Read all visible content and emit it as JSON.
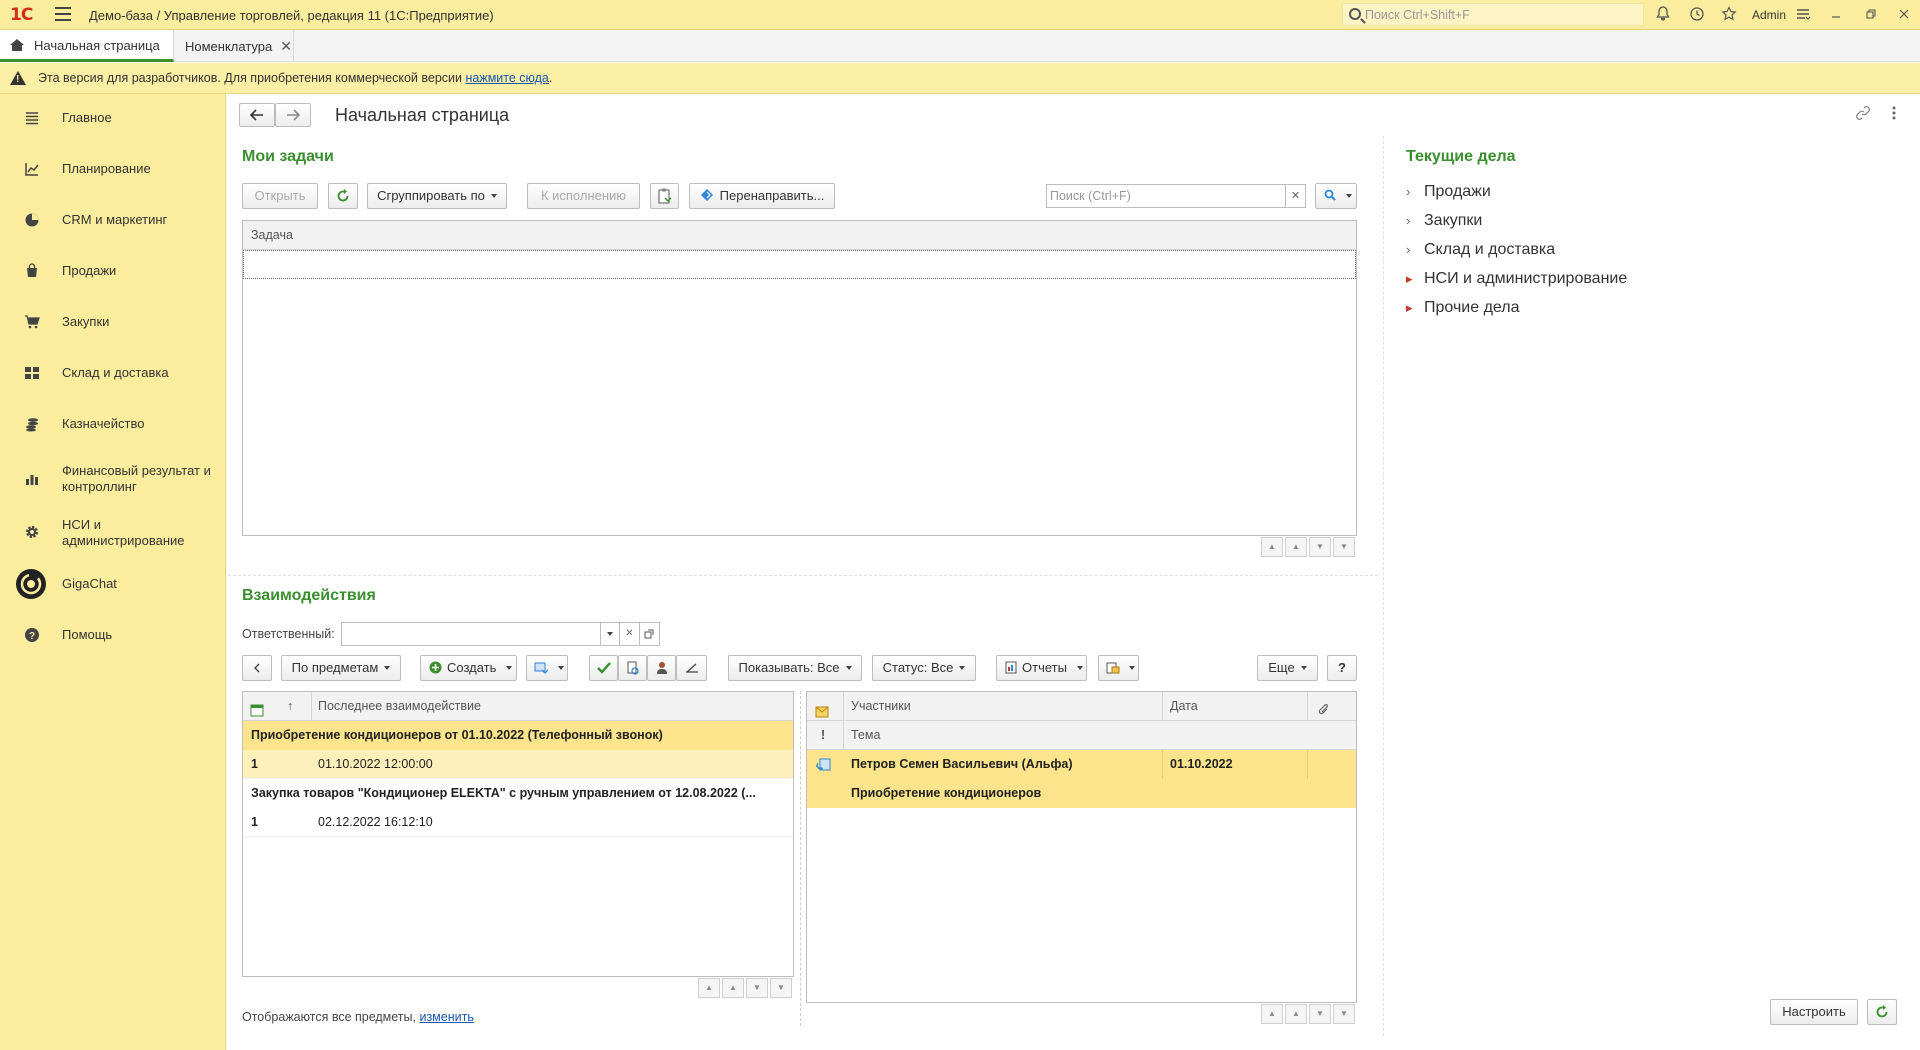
{
  "titlebar": {
    "logo": "1С",
    "title": "Демо-база / Управление торговлей, редакция 11  (1С:Предприятие)",
    "search_placeholder": "Поиск Ctrl+Shift+F",
    "user": "Admin"
  },
  "tabs": [
    {
      "label": "Начальная страница"
    },
    {
      "label": "Номенклатура"
    }
  ],
  "banner": {
    "text": "Эта версия для разработчиков. Для приобретения коммерческой версии ",
    "link": "нажмите сюда",
    "suffix": "."
  },
  "sidebar": {
    "items": [
      {
        "label": "Главное",
        "icon": "menu-icon"
      },
      {
        "label": "Планирование",
        "icon": "planning-icon"
      },
      {
        "label": "CRM и маркетинг",
        "icon": "crm-icon"
      },
      {
        "label": "Продажи",
        "icon": "sales-icon"
      },
      {
        "label": "Закупки",
        "icon": "cart-icon"
      },
      {
        "label": "Склад и доставка",
        "icon": "warehouse-icon"
      },
      {
        "label": "Казначейство",
        "icon": "treasury-icon"
      },
      {
        "label": "Финансовый результат и контроллинг",
        "icon": "finance-icon"
      },
      {
        "label": "НСИ и администрирование",
        "icon": "gear-icon"
      },
      {
        "label": "GigaChat",
        "icon": "gigachat-icon"
      },
      {
        "label": "Помощь",
        "icon": "help-icon"
      }
    ]
  },
  "page": {
    "title": "Начальная страница"
  },
  "tasks": {
    "title": "Мои задачи",
    "open": "Открыть",
    "group_by": "Сгруппировать по",
    "to_execution": "К исполнению",
    "redirect": "Перенаправить...",
    "search_placeholder": "Поиск (Ctrl+F)",
    "column": "Задача"
  },
  "interactions": {
    "title": "Взаимодействия",
    "responsible_label": "Ответственный:",
    "by_subjects": "По предметам",
    "create": "Создать",
    "show": "Показывать: Все",
    "status": "Статус: Все",
    "reports": "Отчеты",
    "more": "Еще",
    "help": "?",
    "left_columns": {
      "sort": "↑",
      "last": "Последнее взаимодействие"
    },
    "left_rows": [
      {
        "subject": "Приобретение кондиционеров от 01.10.2022 (Телефонный звонок)",
        "count": "1",
        "date": "01.10.2022 12:00:00"
      },
      {
        "subject": "Закупка товаров \"Кондиционер ELEKTA\" с ручным управлением от 12.08.2022 (...",
        "count": "1",
        "date": "02.12.2022 16:12:10"
      }
    ],
    "right_columns": {
      "participants": "Участники",
      "date": "Дата",
      "mark": "!",
      "topic": "Тема"
    },
    "right_rows": [
      {
        "participants": "Петров Семен Васильевич (Альфа)",
        "date": "01.10.2022",
        "topic": "Приобретение кондиционеров"
      }
    ],
    "footer_text": "Отображаются все предметы, ",
    "footer_link": "изменить"
  },
  "current": {
    "title": "Текущие дела",
    "items": [
      {
        "label": "Продажи",
        "alert": false
      },
      {
        "label": "Закупки",
        "alert": false
      },
      {
        "label": "Склад и доставка",
        "alert": false
      },
      {
        "label": "НСИ и администрирование",
        "alert": true
      },
      {
        "label": "Прочие дела",
        "alert": true
      }
    ],
    "customize": "Настроить"
  },
  "colors": {
    "accent_green": "#3a8f2f",
    "sidebar_bg": "#fbed9e",
    "selection": "#fbe48c",
    "alert_red": "#c0392b"
  }
}
